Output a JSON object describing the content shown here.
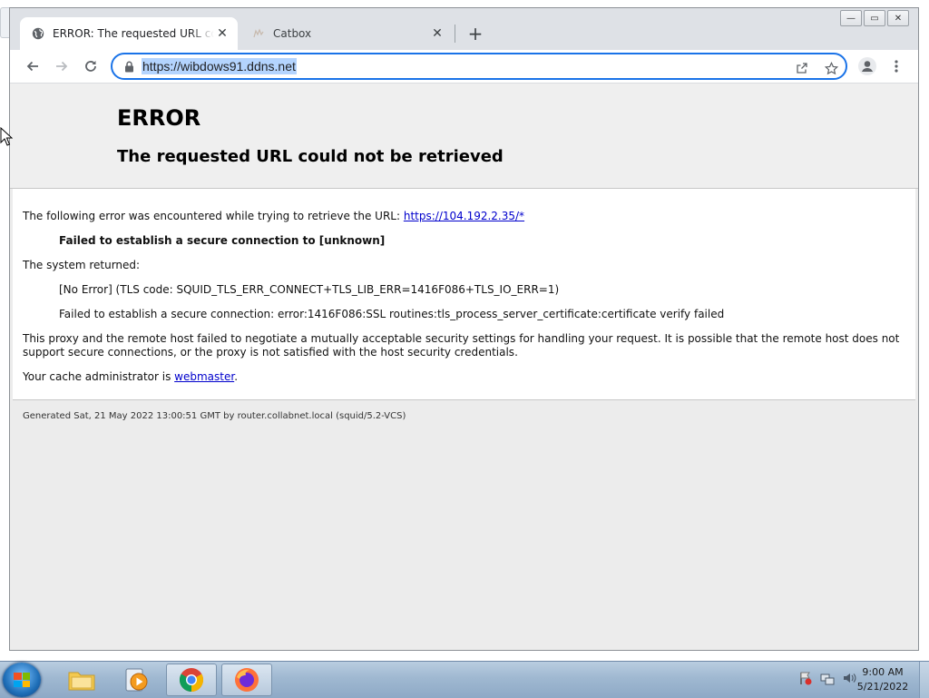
{
  "browser": {
    "tabs": [
      {
        "title": "ERROR: The requested URL could not be retrieved",
        "active": true,
        "close_label": "✕"
      },
      {
        "title": "Catbox",
        "active": false,
        "close_label": "✕"
      }
    ],
    "new_tab_label": "+",
    "window_controls": {
      "minimize": "—",
      "maximize": "▭",
      "close": "✕"
    },
    "address_bar": {
      "url": "https://wibdows91.ddns.net"
    },
    "accent_color": "#1a73e8"
  },
  "page": {
    "heading": "ERROR",
    "subheading": "The requested URL could not be retrieved",
    "intro_text": "The following error was encountered while trying to retrieve the URL: ",
    "intro_link": "https://104.192.2.35/*",
    "error_title": "Failed to establish a secure connection to [unknown]",
    "system_returned_label": "The system returned:",
    "system_detail_1": "[No Error] (TLS code: SQUID_TLS_ERR_CONNECT+TLS_LIB_ERR=1416F086+TLS_IO_ERR=1)",
    "system_detail_2": "Failed to establish a secure connection: error:1416F086:SSL routines:tls_process_server_certificate:certificate verify failed",
    "explanation": "This proxy and the remote host failed to negotiate a mutually acceptable security settings for handling your request. It is possible that the remote host does not support secure connections, or the proxy is not satisfied with the host security credentials.",
    "admin_prefix": "Your cache administrator is ",
    "admin_link": "webmaster",
    "admin_suffix": ".",
    "footer": "Generated Sat, 21 May 2022 13:00:51 GMT by router.collabnet.local (squid/5.2-VCS)"
  },
  "taskbar": {
    "items": [
      "start-button",
      "file-explorer",
      "media-player",
      "chrome",
      "firefox"
    ],
    "clock_time": "9:00 AM",
    "clock_date": "5/21/2022"
  }
}
